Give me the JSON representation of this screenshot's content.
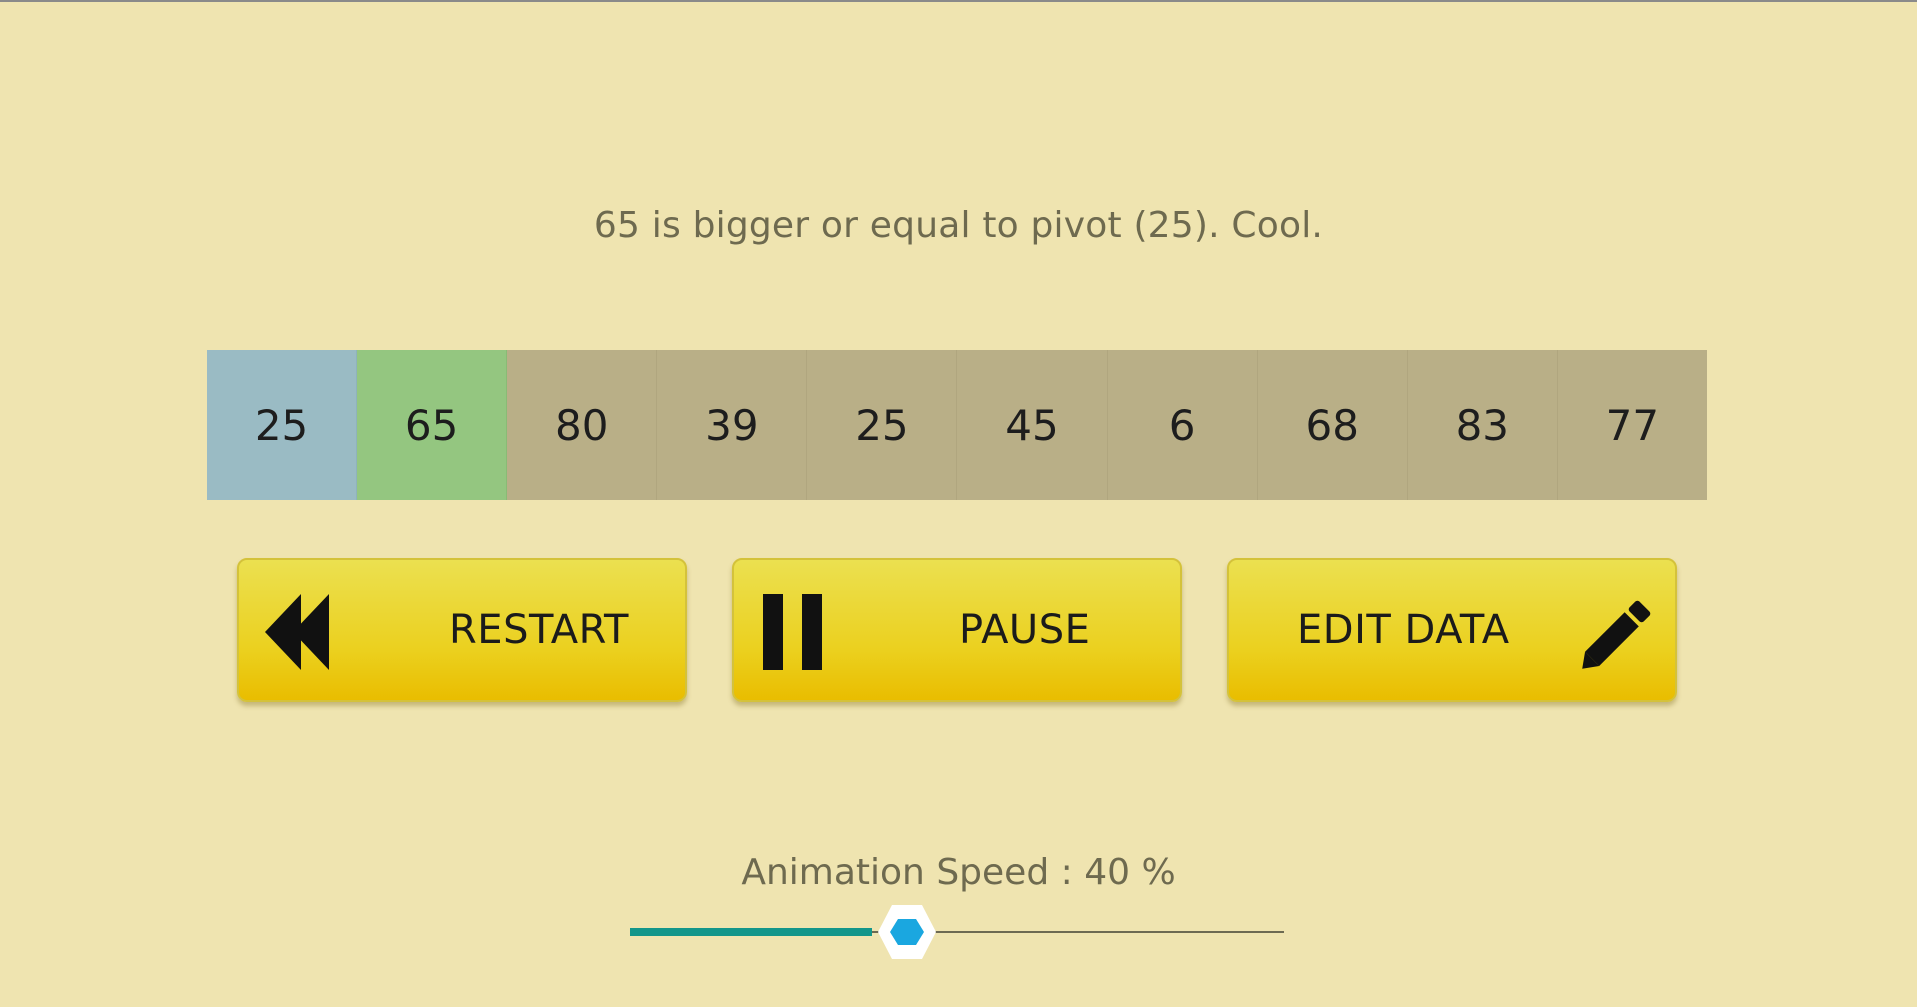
{
  "message": "65 is bigger or equal to pivot (25). Cool.",
  "array": {
    "cells": [
      "25",
      "65",
      "80",
      "39",
      "25",
      "45",
      "6",
      "68",
      "83",
      "77"
    ],
    "pivot_index": 0,
    "current_index": 1
  },
  "buttons": {
    "restart": {
      "label": "RESTART",
      "icon": "rewind-icon"
    },
    "pause": {
      "label": "PAUSE",
      "icon": "pause-icon"
    },
    "edit": {
      "label": "EDIT DATA",
      "icon": "pencil-icon"
    }
  },
  "speed": {
    "label": "Animation Speed : 40 %",
    "value_fraction": 0.4
  },
  "colors": {
    "background": "#efe4b0",
    "cell_default": "#b9af87",
    "cell_pivot": "#9abbc4",
    "cell_current": "#94c680",
    "button": "#ebd01e",
    "slider_fill": "#13968a",
    "slider_thumb": "#1aa7e0"
  }
}
